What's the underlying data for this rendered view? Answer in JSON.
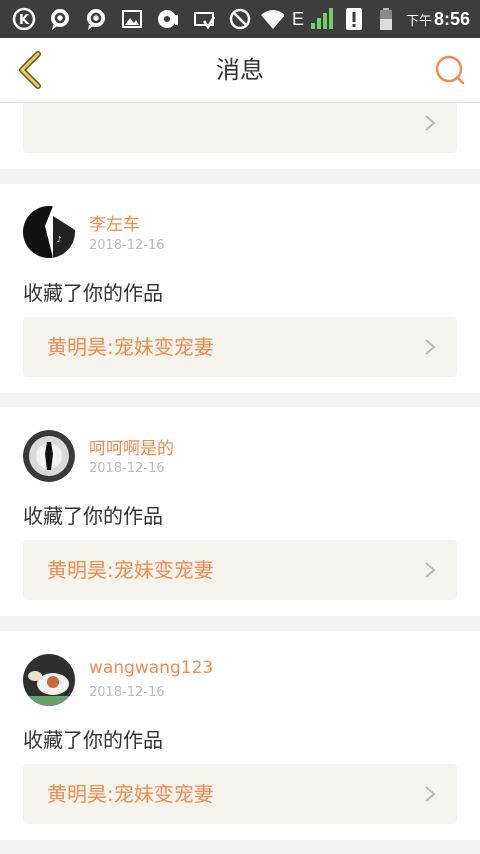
{
  "status_bar": {
    "time_prefix": "下午",
    "time": "8:56",
    "network": "E",
    "icons": [
      "k-app-icon",
      "chat-icon",
      "chat-icon",
      "image-icon",
      "music-icon",
      "notification-icon",
      "blocked-icon",
      "wifi-icon",
      "signal-icon",
      "alert-icon",
      "battery-icon"
    ]
  },
  "header": {
    "title": "消息",
    "back_icon": "chevron-left-icon",
    "search_icon": "search-icon"
  },
  "colors": {
    "accent": "#ef8c4f",
    "work_bg": "#f4f3ee",
    "page_bg": "#f2f2f2"
  },
  "messages": [
    {
      "username": "李左车",
      "date": "2018-12-16",
      "action": "收藏了你的作品",
      "work_title": "黄明昊:宠妹变宠妻"
    },
    {
      "username": "呵呵啊是的",
      "date": "2018-12-16",
      "action": "收藏了你的作品",
      "work_title": "黄明昊:宠妹变宠妻"
    },
    {
      "username": "wangwang123",
      "date": "2018-12-16",
      "action": "收藏了你的作品",
      "work_title": "黄明昊:宠妹变宠妻"
    }
  ]
}
